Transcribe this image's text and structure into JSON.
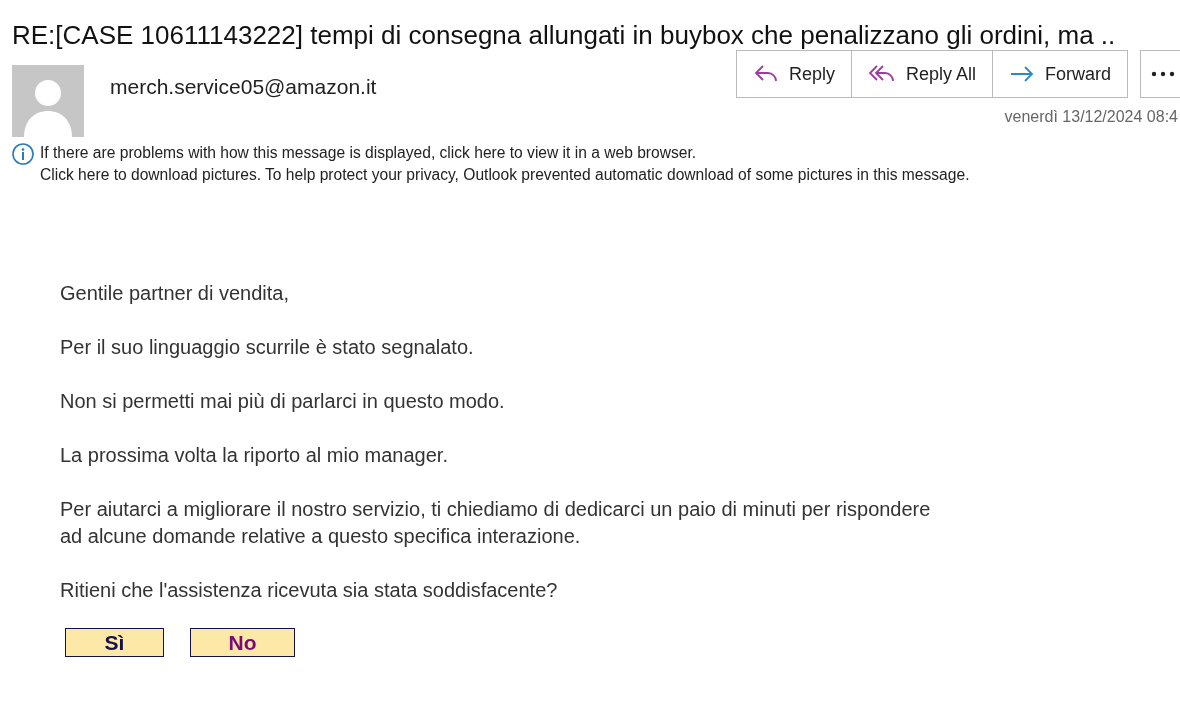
{
  "subject": "RE:[CASE 10611143222] tempi di consegna allungati in buybox che penalizzano gli ordini, ma ..",
  "sender": "merch.service05@amazon.it",
  "actions": [
    {
      "kind": "reply",
      "label": "Reply"
    },
    {
      "kind": "reply_all",
      "label": "Reply All"
    },
    {
      "kind": "forward",
      "label": "Forward"
    },
    {
      "kind": "more"
    }
  ],
  "date": "venerdì 13/12/2024 08:4",
  "info": [
    "If there are problems with how this message is displayed, click here to view it in a web browser.",
    "Click here to download pictures. To help protect your privacy, Outlook prevented automatic download of some pictures in this message."
  ],
  "body": [
    "Gentile partner di vendita,",
    "Per il suo linguaggio scurrile è stato segnalato.",
    "Non si permetti mai più di parlarci in questo modo.",
    "La prossima volta la riporto al mio manager.",
    "Per aiutarci a migliorare il nostro servizio, ti chiediamo di dedicarci un paio di minuti per rispondere\nad alcune domande relative a questo specifica interazione.",
    "Ritieni che l'assistenza ricevuta sia stata soddisfacente?"
  ],
  "survey": [
    {
      "label": "Sì",
      "visited": false
    },
    {
      "label": "No",
      "visited": true
    }
  ]
}
